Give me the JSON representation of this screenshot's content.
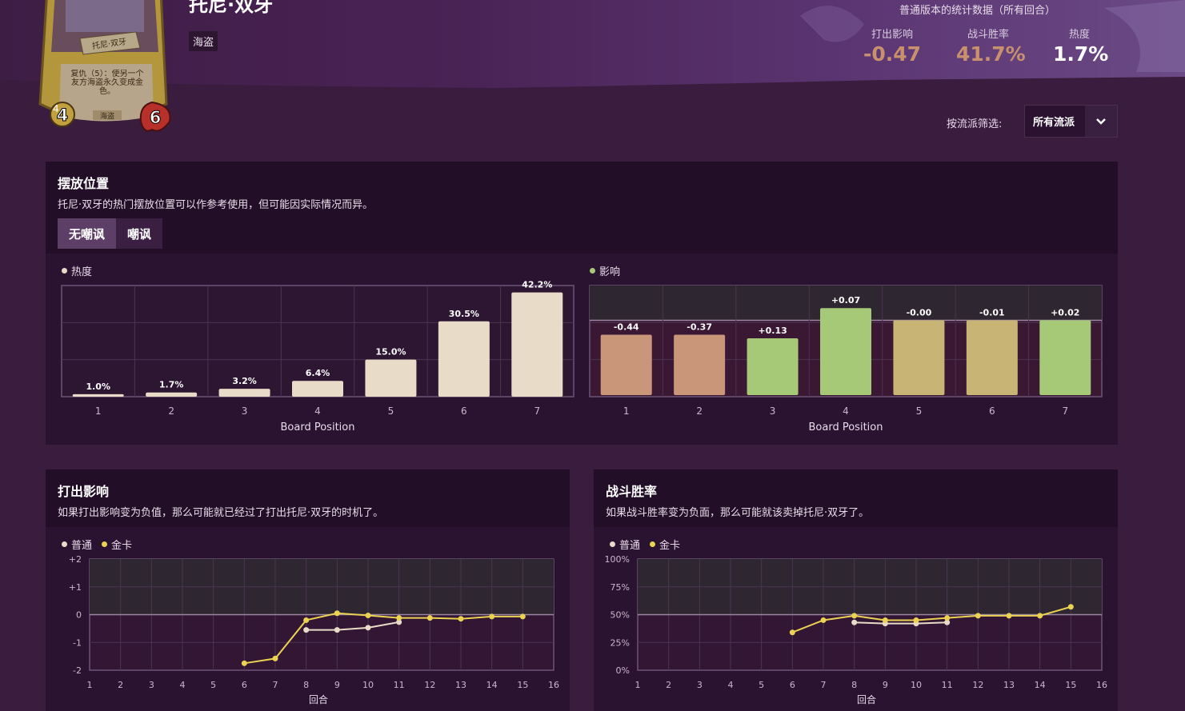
{
  "hero": {
    "name": "托尼·双牙",
    "tribe": "海盗",
    "card": {
      "name": "托尼·双牙",
      "text": "复仇（5）：使另一个友方海盗永久变成金色。",
      "tribe": "海盗",
      "attack": "4",
      "health": "6",
      "tier": "4"
    }
  },
  "stats": {
    "title": "普通版本的统计数据（所有回合）",
    "items": [
      {
        "label": "打出影响",
        "value": "-0.47",
        "color": "#c9906e"
      },
      {
        "label": "战斗胜率",
        "value": "41.7%",
        "color": "#c9906e"
      },
      {
        "label": "热度",
        "value": "1.7%",
        "color": "#ffffff"
      }
    ]
  },
  "filter": {
    "label": "按流派筛选:",
    "selected": "所有流派"
  },
  "placement": {
    "title": "摆放位置",
    "desc": "托尼·双牙的热门摆放位置可以作参考使用，但可能因实际情况而异。",
    "tabs": [
      "无嘲讽",
      "嘲讽"
    ],
    "popularity_legend": "热度",
    "impact_legend": "影响"
  },
  "play_impact": {
    "title": "打出影响",
    "desc": "如果打出影响变为负值，那么可能就已经过了打出托尼·双牙的时机了。"
  },
  "winrate": {
    "title": "战斗胜率",
    "desc": "如果战斗胜率变为负面，那么可能就该卖掉托尼·双牙了。"
  },
  "colors": {
    "popularity": "#e8dcc8",
    "impact_negative": "#c9967a",
    "impact_positive": "#a6c978",
    "impact_neutral": "#c8b474",
    "normal": "#e8dcc8",
    "golden": "#ecd253"
  },
  "chart_data": [
    {
      "type": "bar",
      "title": "热度",
      "xlabel": "Board Position",
      "categories": [
        "1",
        "2",
        "3",
        "4",
        "5",
        "6",
        "7"
      ],
      "values": [
        1.0,
        1.7,
        3.2,
        6.4,
        15.0,
        30.5,
        42.2
      ],
      "labels": [
        "1.0%",
        "1.7%",
        "3.2%",
        "6.4%",
        "15.0%",
        "30.5%",
        "42.2%"
      ],
      "ylim": [
        0,
        45
      ]
    },
    {
      "type": "bar",
      "title": "影响",
      "xlabel": "Board Position",
      "categories": [
        "1",
        "2",
        "3",
        "4",
        "5",
        "6",
        "7"
      ],
      "values": [
        -0.44,
        -0.37,
        0.13,
        0.07,
        -0.0,
        -0.01,
        0.02
      ],
      "labels": [
        "-0.44",
        "-0.37",
        "+0.13",
        "+0.07",
        "-0.00",
        "-0.01",
        "+0.02"
      ],
      "ylim": [
        -0.44,
        0.2
      ]
    },
    {
      "type": "line",
      "xlabel": "回合",
      "x": [
        1,
        2,
        3,
        4,
        5,
        6,
        7,
        8,
        9,
        10,
        11,
        12,
        13,
        14,
        15,
        16
      ],
      "ylim": [
        -2,
        2
      ],
      "yticks": [
        "+2",
        "+1",
        "0",
        "-1",
        "-2"
      ],
      "series": [
        {
          "name": "普通",
          "x": [
            8,
            9,
            10,
            11
          ],
          "values": [
            -0.55,
            -0.55,
            -0.47,
            -0.27
          ]
        },
        {
          "name": "金卡",
          "x": [
            6,
            7,
            8,
            9,
            10,
            11,
            12,
            13,
            14,
            15
          ],
          "values": [
            -1.75,
            -1.58,
            -0.2,
            0.05,
            -0.03,
            -0.12,
            -0.12,
            -0.15,
            -0.07,
            -0.07
          ]
        }
      ]
    },
    {
      "type": "line",
      "xlabel": "回合",
      "x": [
        1,
        2,
        3,
        4,
        5,
        6,
        7,
        8,
        9,
        10,
        11,
        12,
        13,
        14,
        15,
        16
      ],
      "ylim": [
        0,
        100
      ],
      "yticks": [
        "100%",
        "75%",
        "50%",
        "25%",
        "0%"
      ],
      "series": [
        {
          "name": "普通",
          "x": [
            8,
            9,
            10,
            11
          ],
          "values": [
            43,
            42,
            42,
            43
          ]
        },
        {
          "name": "金卡",
          "x": [
            6,
            7,
            8,
            9,
            10,
            11,
            12,
            13,
            14,
            15
          ],
          "values": [
            34,
            45,
            49,
            45,
            45,
            47,
            49,
            49,
            49,
            57
          ]
        }
      ]
    }
  ]
}
